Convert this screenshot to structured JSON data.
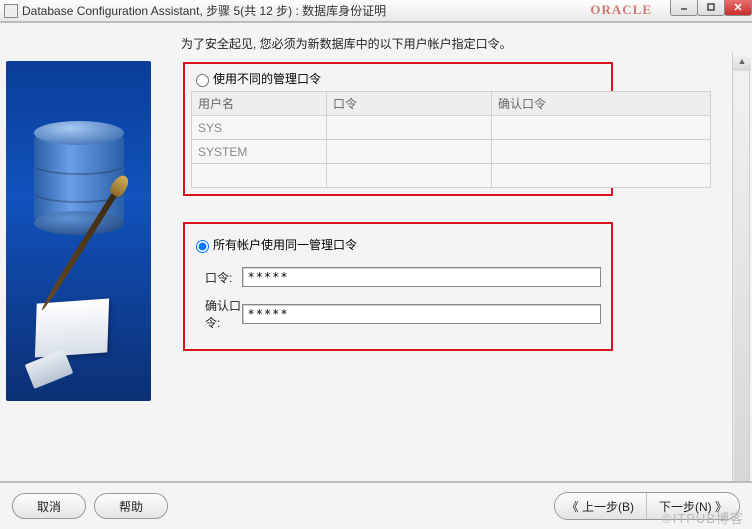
{
  "window": {
    "app": "Database Configuration Assistant",
    "step_label": "步骤 5(共 12 步)",
    "page_name": "数据库身份证明",
    "full_title": "Database Configuration Assistant, 步骤 5(共 12 步) : 数据库身份证明",
    "brand": "ORACLE"
  },
  "instruction": "为了安全起见, 您必须为新数据库中的以下用户帐户指定口令。",
  "option1": {
    "label": "使用不同的管理口令",
    "selected": false,
    "table": {
      "headers": {
        "user": "用户名",
        "password": "口令",
        "confirm": "确认口令"
      },
      "rows": [
        {
          "user": "SYS",
          "password": "",
          "confirm": ""
        },
        {
          "user": "SYSTEM",
          "password": "",
          "confirm": ""
        }
      ]
    }
  },
  "option2": {
    "label": "所有帐户使用同一管理口令",
    "selected": true,
    "password_label": "口令:",
    "confirm_label": "确认口令:",
    "password_value": "*****",
    "confirm_value": "*****"
  },
  "buttons": {
    "cancel": "取消",
    "help": "帮助",
    "back": "上一步(B)",
    "next": "下一步(N)",
    "prev_glyph": "《",
    "next_glyph": "》"
  },
  "watermark": "©ITPUB博客"
}
